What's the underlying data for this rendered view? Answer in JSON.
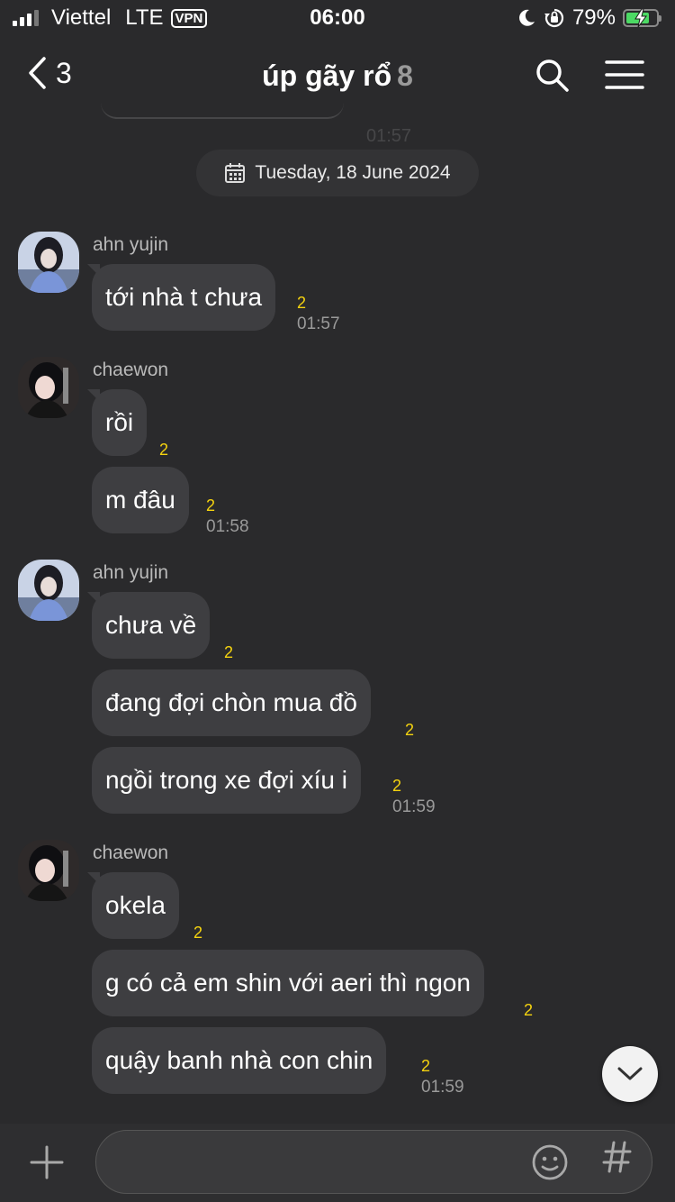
{
  "status_bar": {
    "carrier": "Viettel",
    "network": "LTE",
    "vpn": "VPN",
    "time": "06:00",
    "battery": "79%",
    "battery_level": 0.79,
    "icons": [
      "signal-bars-icon",
      "moon-icon",
      "rotation-lock-icon",
      "battery-charging-icon"
    ]
  },
  "nav": {
    "back_count": "3",
    "title": "úp gãy rổ",
    "member_count": "8",
    "icons": [
      "back-chevron-icon",
      "search-icon",
      "hamburger-menu-icon"
    ]
  },
  "date_divider": "Tuesday, 18 June 2024",
  "messages": [
    {
      "sender": "ahn yujin",
      "text": "tới nhà t chưa",
      "unread": "2",
      "time": "01:57"
    },
    {
      "sender": "chaewon",
      "text": "rồi",
      "unread": "2",
      "time": ""
    },
    {
      "sender": "chaewon",
      "text": "m đâu",
      "unread": "2",
      "time": "01:58"
    },
    {
      "sender": "ahn yujin",
      "text": "chưa về",
      "unread": "2",
      "time": ""
    },
    {
      "sender": "ahn yujin",
      "text": "đang đợi chòn mua đồ",
      "unread": "2",
      "time": ""
    },
    {
      "sender": "ahn yujin",
      "text": "ngồi trong xe đợi xíu i",
      "unread": "2",
      "time": "01:59"
    },
    {
      "sender": "chaewon",
      "text": "okela",
      "unread": "2",
      "time": ""
    },
    {
      "sender": "chaewon",
      "text": "g có cả em shin với aeri thì ngon",
      "unread": "2",
      "time": ""
    },
    {
      "sender": "chaewon",
      "text": "quậy banh nhà con chin",
      "unread": "2",
      "time": "01:59"
    }
  ],
  "input": {
    "value": "",
    "placeholder": ""
  },
  "colors": {
    "background": "#2a2a2c",
    "bubble": "#3e3e41",
    "unread": "#f5d30f",
    "battery": "#4cd964"
  }
}
